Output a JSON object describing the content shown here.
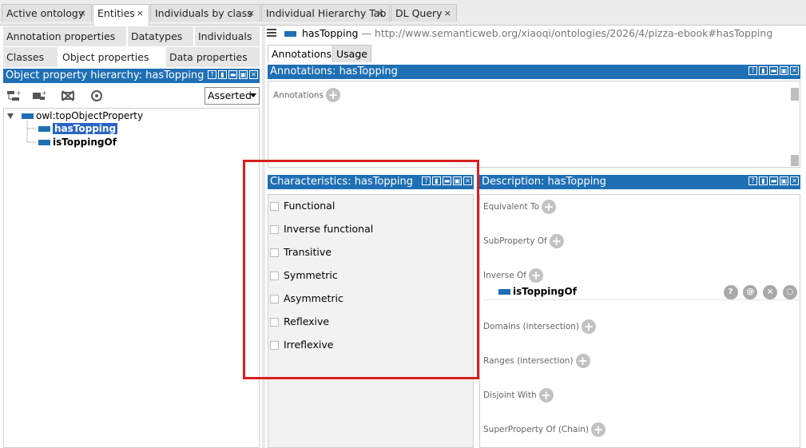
{
  "top_tabs": [
    "Active ontology",
    "Entities",
    "Individuals by class",
    "Individual Hierarchy Tab",
    "DL Query"
  ],
  "close_glyph": "×",
  "entity_tabs_row1": [
    "Annotation properties",
    "Datatypes",
    "Individuals"
  ],
  "entity_tabs_row2": [
    "Classes",
    "Object properties",
    "Data properties"
  ],
  "hierarchy_header": "Object property hierarchy: hasTopping",
  "header_buttons": [
    "?",
    "▮",
    "▬",
    "▣",
    "✕"
  ],
  "hierarchy_select": "Asserted",
  "tree": {
    "root": "owl:topObjectProperty",
    "children": [
      "hasTopping",
      "isToppingOf"
    ]
  },
  "entity": {
    "name": "hasTopping",
    "separator": "—",
    "iri": "http://www.semanticweb.org/xiaoqi/ontologies/2026/4/pizza-ebook#hasTopping"
  },
  "right_tabs": [
    "Annotations",
    "Usage"
  ],
  "annotations_header": "Annotations: hasTopping",
  "annotations_label": "Annotations",
  "characteristics_header": "Characteristics: hasTopping",
  "characteristics": [
    "Functional",
    "Inverse functional",
    "Transitive",
    "Symmetric",
    "Asymmetric",
    "Reflexive",
    "Irreflexive"
  ],
  "description_header": "Description: hasTopping",
  "description": {
    "equivalent_to": "Equivalent To",
    "subproperty_of": "SubProperty Of",
    "inverse_of": "Inverse Of",
    "inverse_value": "isToppingOf",
    "domains": "Domains (intersection)",
    "ranges": "Ranges (intersection)",
    "disjoint_with": "Disjoint With",
    "superproperty_chain": "SuperProperty Of (Chain)"
  },
  "row_buttons": [
    "?",
    "@",
    "×",
    "○"
  ],
  "colors": {
    "header_blue": "#1f6fb5",
    "highlight_red": "#d71f1f"
  }
}
